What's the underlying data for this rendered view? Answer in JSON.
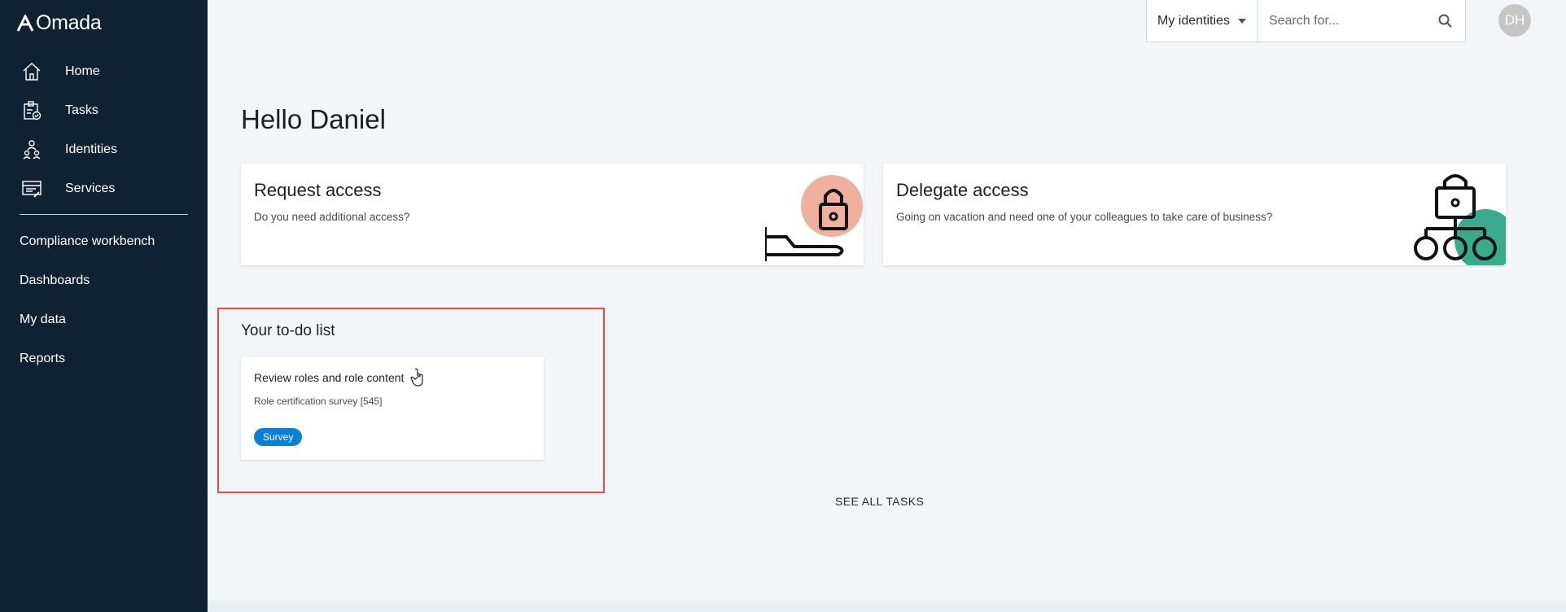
{
  "app": {
    "logo_text": "Omada"
  },
  "sidebar": {
    "items": [
      {
        "label": "Home",
        "icon": "home-icon"
      },
      {
        "label": "Tasks",
        "icon": "tasks-icon"
      },
      {
        "label": "Identities",
        "icon": "identities-icon"
      },
      {
        "label": "Services",
        "icon": "services-icon"
      }
    ],
    "links": [
      {
        "label": "Compliance workbench"
      },
      {
        "label": "Dashboards"
      },
      {
        "label": "My data"
      },
      {
        "label": "Reports"
      }
    ]
  },
  "topbar": {
    "identity_select": "My identities",
    "search_placeholder": "Search for...",
    "avatar_initials": "DH"
  },
  "main": {
    "greeting": "Hello Daniel",
    "cards": [
      {
        "title": "Request access",
        "description": "Do you need additional access?"
      },
      {
        "title": "Delegate access",
        "description": "Going on vacation and need one of your colleagues to take care of business?"
      }
    ],
    "todo": {
      "title": "Your to-do list",
      "items": [
        {
          "name": "Review roles and role content",
          "subtitle": "Role certification survey [545]",
          "badge": "Survey"
        }
      ],
      "see_all": "SEE ALL TASKS"
    }
  },
  "colors": {
    "sidebar_bg": "#0f2233",
    "accent_blue": "#0a7fd8",
    "highlight_red": "#e34b4b",
    "illustration_salmon": "#efb0a0",
    "illustration_teal": "#3aaa8c"
  }
}
